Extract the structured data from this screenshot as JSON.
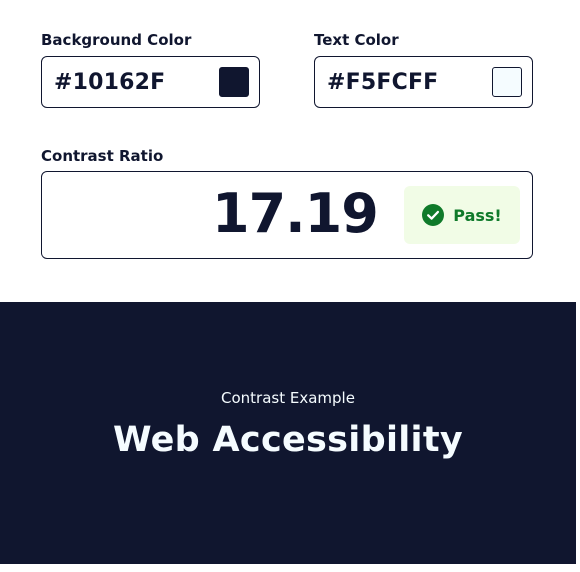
{
  "background": {
    "label": "Background Color",
    "value": "#10162F",
    "swatch_color": "#10162F"
  },
  "text_color": {
    "label": "Text Color",
    "value": "#F5FCFF",
    "swatch_color": "#F5FCFF"
  },
  "contrast": {
    "label": "Contrast Ratio",
    "value": "17.19",
    "status": "Pass!",
    "status_icon": "check-circle-icon",
    "status_color": "#0F7A2A",
    "status_bg": "#F1FCE6"
  },
  "example": {
    "eyebrow": "Contrast Example",
    "heading": "Web Accessibility"
  }
}
